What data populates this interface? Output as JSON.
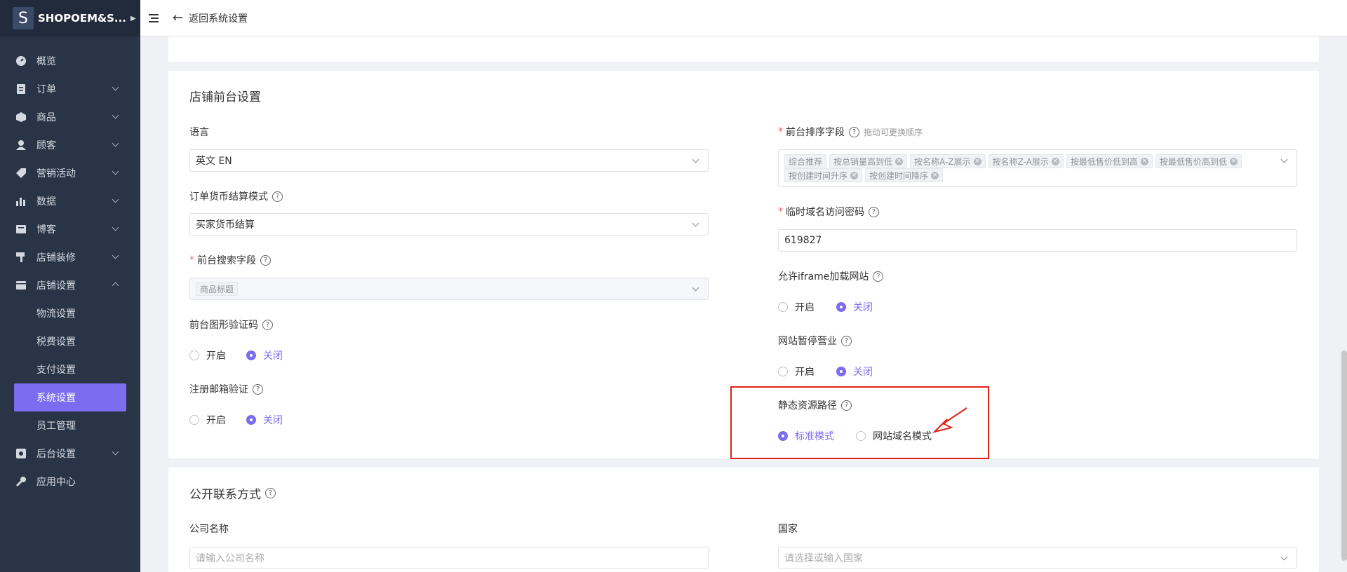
{
  "app": {
    "name": "SHOPOEM&S...",
    "logo_letter": "S"
  },
  "sidebar": {
    "items": [
      {
        "label": "概览",
        "icon": "dashboard-icon"
      },
      {
        "label": "订单",
        "icon": "order-icon"
      },
      {
        "label": "商品",
        "icon": "box-icon"
      },
      {
        "label": "顾客",
        "icon": "user-icon"
      },
      {
        "label": "营销活动",
        "icon": "tag-icon"
      },
      {
        "label": "数据",
        "icon": "chart-icon"
      },
      {
        "label": "博客",
        "icon": "blog-icon"
      },
      {
        "label": "店铺装修",
        "icon": "paint-icon"
      },
      {
        "label": "店铺设置",
        "icon": "store-icon"
      }
    ],
    "sub": [
      "物流设置",
      "税费设置",
      "支付设置",
      "系统设置",
      "员工管理"
    ],
    "after": [
      {
        "label": "后台设置",
        "icon": "admin-icon"
      },
      {
        "label": "应用中心",
        "icon": "wrench-icon"
      }
    ]
  },
  "topbar": {
    "back_label": "返回系统设置"
  },
  "store": {
    "title": "店铺前台设置",
    "language_label": "语言",
    "language_value": "英文 EN",
    "currency_label": "订单货币结算模式",
    "currency_value": "买家货币结算",
    "search_label": "前台搜索字段",
    "search_tag": "商品标题",
    "captcha_label": "前台图形验证码",
    "email_label": "注册邮箱验证",
    "sort_label": "前台排序字段",
    "sort_hint": "拖动可更换顺序",
    "sort_tags": [
      "综合推荐",
      "按总销量高到低",
      "按名称A-Z展示",
      "按名称Z-A展示",
      "按最低售价低到高",
      "按最低售价高到低",
      "按创建时间升序",
      "按创建时间降序"
    ],
    "temp_pwd_label": "临时域名访问密码",
    "temp_pwd_value": "619827",
    "iframe_label": "允许iframe加载网站",
    "pause_label": "网站暂停营业",
    "static_label": "静态资源路径",
    "opt_on": "开启",
    "opt_off": "关闭",
    "opt_std": "标准模式",
    "opt_domain": "网站域名模式"
  },
  "contact": {
    "title": "公开联系方式",
    "company_label": "公司名称",
    "company_ph": "请输入公司名称",
    "country_label": "国家",
    "country_ph": "请选择或输入国家"
  },
  "colors": {
    "accent": "#7b6cf0",
    "sidebar": "#2a3447",
    "highlight": "#e2231a"
  }
}
